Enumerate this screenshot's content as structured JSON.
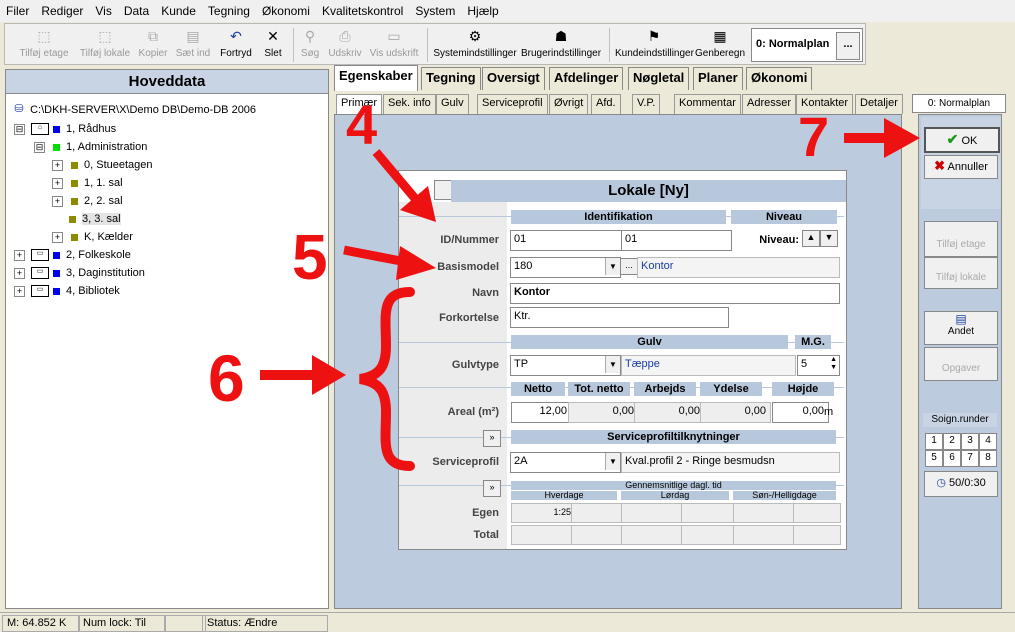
{
  "menu": [
    "Filer",
    "Rediger",
    "Vis",
    "Data",
    "Kunde",
    "Tegning",
    "Økonomi",
    "Kvalitetskontrol",
    "System",
    "Hjælp"
  ],
  "toolbar": {
    "tilfoj_etage": "Tilføj etage",
    "tilfoj_lokale": "Tilføj lokale",
    "kopier": "Kopier",
    "saet_ind": "Sæt ind",
    "fortryd": "Fortryd",
    "slet": "Slet",
    "sog": "Søg",
    "udskriv": "Udskriv",
    "vis_udskrift": "Vis udskrift",
    "systemindstillinger": "Systemindstillinger",
    "brugerindstillinger": "Brugerindstillinger",
    "kundeindstillinger": "Kundeindstillinger",
    "genberegn": "Genberegn",
    "plan": "0: Normalplan",
    "plan_dots": "..."
  },
  "left": {
    "title": "Hoveddata",
    "root": "C:\\DKH-SERVER\\X\\Demo DB\\Demo-DB 2006",
    "items": [
      {
        "label": "1, Rådhus",
        "exp": "⊟"
      },
      {
        "label": "1, Administration",
        "exp": "⊟"
      },
      {
        "label": "0, Stueetagen",
        "exp": "+"
      },
      {
        "label": "1, 1. sal",
        "exp": "+"
      },
      {
        "label": "2, 2. sal",
        "exp": "+"
      },
      {
        "label": "3, 3. sal",
        "exp": ""
      },
      {
        "label": "K, Kælder",
        "exp": "+"
      },
      {
        "label": "2, Folkeskole",
        "exp": "+"
      },
      {
        "label": "3, Daginstitution",
        "exp": "+"
      },
      {
        "label": "4, Bibliotek",
        "exp": "+"
      }
    ]
  },
  "tabs": [
    "Egenskaber",
    "Tegning",
    "Oversigt",
    "Afdelinger",
    "Nøgletal",
    "Planer",
    "Økonomi"
  ],
  "subtabs": [
    "Primær",
    "Sek. info",
    "Gulv",
    "Serviceprofil",
    "Øvrigt",
    "Afd.",
    "V.P.",
    "Kommentar",
    "Adresser",
    "Kontakter",
    "Detaljer"
  ],
  "plan_tab": "0: Normalplan",
  "dialog": {
    "title": "Lokale [Ny]",
    "identifikation": "Identifikation",
    "niveau_hdr": "Niveau",
    "id_label": "ID/Nummer",
    "id1": "01",
    "id2": "01",
    "niveau_label": "Niveau:",
    "basismodel_label": "Basismodel",
    "basismodel": "180",
    "basismodel_btn": "...",
    "basismodel_desc": "Kontor",
    "navn_label": "Navn",
    "navn": "Kontor",
    "forkortelse_label": "Forkortelse",
    "forkortelse": "Ktr.",
    "gulv_hdr": "Gulv",
    "mg_hdr": "M.G.",
    "gulvtype_label": "Gulvtype",
    "gulvtype": "TP",
    "gulvtype_desc": "Tæppe",
    "mg": "5",
    "netto_hdr": "Netto",
    "totnetto_hdr": "Tot. netto",
    "arbejds_hdr": "Arbejds",
    "ydelse_hdr": "Ydelse",
    "hojde_hdr": "Højde",
    "areal_label": "Areal (m²)",
    "netto": "12,00",
    "totnetto": "0,00",
    "arbejds": "0,00",
    "ydelse": "0,00",
    "hojde": "0,00",
    "unit_m": "m",
    "sp_hdr": "Serviceprofiltilknytninger",
    "sp_label": "Serviceprofil",
    "sp": "2A",
    "sp_desc": "Kval.profil 2 - Ringe besmudsn",
    "gns_hdr": "Gennemsnitlige dagl. tid",
    "hverdage": "Hverdage",
    "lordag": "Lørdag",
    "son": "Søn-/Helligdage",
    "egen_label": "Egen",
    "egen_hverdage": "1:25",
    "total_label": "Total",
    "expand": "»"
  },
  "right": {
    "ok": "OK",
    "annuller": "Annuller",
    "tilfoj_etage": "Tilføj etage",
    "tilfoj_lokale": "Tilføj lokale",
    "andet": "Andet",
    "opgaver": "Opgaver",
    "soign_label": "Soign.runder",
    "numbers": [
      "1",
      "2",
      "3",
      "4",
      "5",
      "6",
      "7",
      "8"
    ],
    "counter": "50/0:30"
  },
  "status": {
    "memory": "M: 64.852 K",
    "numlock": "Num lock: Til",
    "status": "Status: Ændre"
  },
  "annotations": [
    "4",
    "5",
    "6",
    "7"
  ],
  "colors": {
    "accent": "#b8c8dc",
    "panel": "#bccbdd",
    "annotation": "#ee1111"
  }
}
